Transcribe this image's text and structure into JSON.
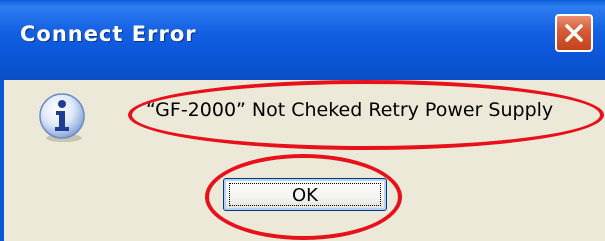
{
  "dialog": {
    "title": "Connect Error",
    "message": "“GF-2000” Not Cheked Retry Power Supply",
    "ok_label": "OK",
    "icon": "info-icon",
    "close_icon": "close-icon"
  },
  "colors": {
    "titlebar": "#0b56d8",
    "client": "#ece9d8",
    "close_button": "#d55a33",
    "highlight": "#e8101a"
  }
}
